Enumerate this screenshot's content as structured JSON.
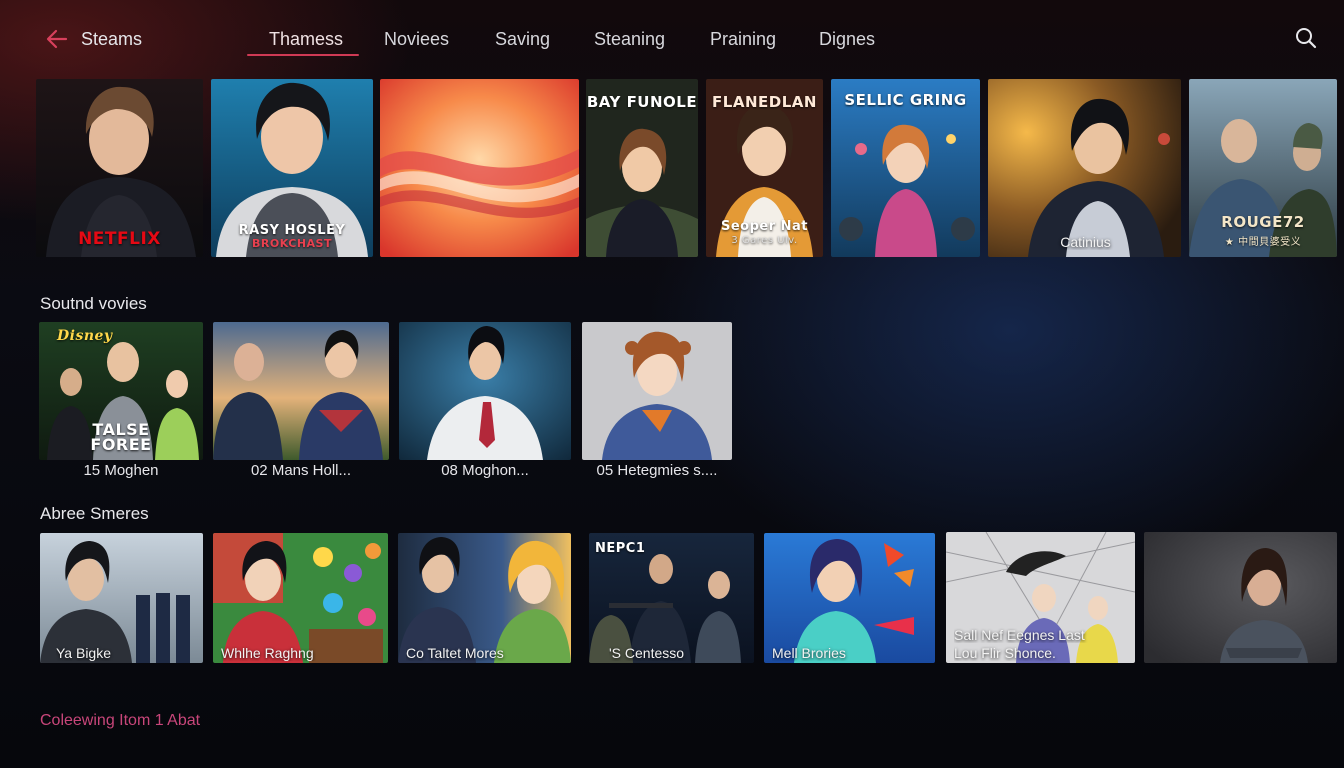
{
  "header": {
    "back_icon": "back-arrow-icon",
    "title": "Steams",
    "tabs": [
      {
        "label": "Thamess",
        "active": true
      },
      {
        "label": "Noviees",
        "active": false
      },
      {
        "label": "Saving",
        "active": false
      },
      {
        "label": "Steaning",
        "active": false
      },
      {
        "label": "Praining",
        "active": false
      },
      {
        "label": "Dignes",
        "active": false
      }
    ],
    "search_icon": "search-icon"
  },
  "featured": {
    "cards": [
      {
        "title": "NETFLIX",
        "subtitle": ""
      },
      {
        "title": "RASY HOSLEY",
        "subtitle": "BROKCHAST"
      },
      {
        "title": "",
        "subtitle": ""
      },
      {
        "title": "BAY FUNOLE",
        "subtitle": ""
      },
      {
        "title": "FLANEDLAN",
        "subtitle": "Seoper Nat",
        "line3": "3 Gares Ulv."
      },
      {
        "title": "SELLIC GRING",
        "subtitle": ""
      },
      {
        "title": "Catinius",
        "subtitle": ""
      },
      {
        "title": "ROUGE72",
        "subtitle": "★ 中間貝婆受义"
      }
    ]
  },
  "sound_movies": {
    "heading": "Soutnd vovies",
    "items": [
      {
        "badge": "Disney",
        "poster_title": "TALSE FOREE",
        "caption": "15 Moghen"
      },
      {
        "caption": "02 Mans Holl..."
      },
      {
        "caption": "08 Moghon..."
      },
      {
        "caption": "05 Hetegmies s...."
      }
    ]
  },
  "abree": {
    "heading": "Abree Smeres",
    "items": [
      {
        "caption": "Ya Bigke"
      },
      {
        "badge": "",
        "caption": "Whlhe Raghng"
      },
      {
        "caption": "Co Taltet Mores"
      },
      {
        "badge": "NEPC1",
        "caption": "'S Centesso"
      },
      {
        "caption": "Mell Brories"
      },
      {
        "caption": "Sall Nef Eegnes Last",
        "caption2": "Lou Flir Shonce."
      },
      {
        "caption": ""
      }
    ]
  },
  "footer": {
    "text": "Coleewing Itom 1 Abat"
  },
  "colors": {
    "accent": "#d03a55",
    "footer_text": "#c8467a",
    "netflix_red": "#e50914"
  }
}
